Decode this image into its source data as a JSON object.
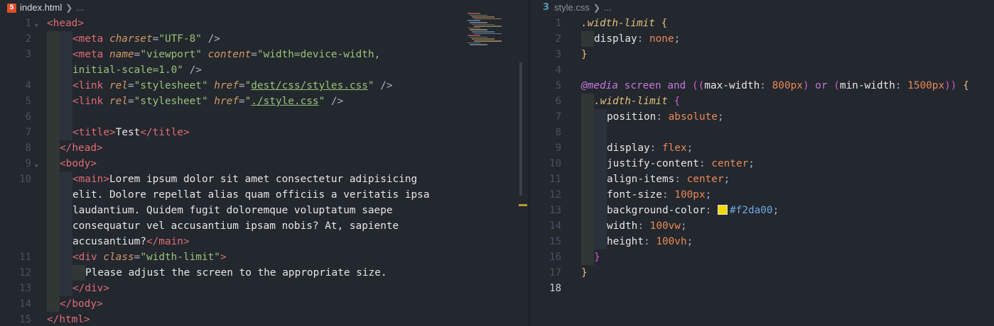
{
  "left_editor": {
    "file_name": "index.html",
    "breadcrumb_more": "...",
    "lines": [
      {
        "n": "1",
        "code": [
          [
            "tag",
            "<head>"
          ]
        ],
        "ind": 0,
        "fold": true
      },
      {
        "n": "2",
        "code": [
          [
            "tag",
            "<meta "
          ],
          [
            "attr",
            "charset"
          ],
          [
            "punct",
            "="
          ],
          [
            "str",
            "\"UTF-8\""
          ],
          [
            "punct",
            " />"
          ]
        ],
        "ind": 2
      },
      {
        "n": "3",
        "code": [
          [
            "tag",
            "<meta "
          ],
          [
            "attr",
            "name"
          ],
          [
            "punct",
            "="
          ],
          [
            "str",
            "\"viewport\""
          ],
          [
            "punct",
            " "
          ],
          [
            "attr",
            "content"
          ],
          [
            "punct",
            "="
          ],
          [
            "str",
            "\"width=device-width,"
          ]
        ],
        "ind": 2
      },
      {
        "n": "",
        "code": [
          [
            "str",
            "initial-scale=1.0\""
          ],
          [
            "punct",
            " />"
          ]
        ],
        "ind": 2
      },
      {
        "n": "4",
        "code": [
          [
            "tag",
            "<link "
          ],
          [
            "attr",
            "rel"
          ],
          [
            "punct",
            "="
          ],
          [
            "str",
            "\"stylesheet\""
          ],
          [
            "punct",
            " "
          ],
          [
            "attr",
            "href"
          ],
          [
            "punct",
            "="
          ],
          [
            "str",
            "\""
          ],
          [
            "strul",
            "dest/css/styles.css"
          ],
          [
            "str",
            "\""
          ],
          [
            "punct",
            " />"
          ]
        ],
        "ind": 2
      },
      {
        "n": "5",
        "code": [
          [
            "tag",
            "<link "
          ],
          [
            "attr",
            "rel"
          ],
          [
            "punct",
            "="
          ],
          [
            "str",
            "\"stylesheet\""
          ],
          [
            "punct",
            " "
          ],
          [
            "attr",
            "href"
          ],
          [
            "punct",
            "="
          ],
          [
            "str",
            "\""
          ],
          [
            "strul",
            "./style.css"
          ],
          [
            "str",
            "\""
          ],
          [
            "punct",
            " />"
          ]
        ],
        "ind": 2
      },
      {
        "n": "6",
        "code": [],
        "ind": 2
      },
      {
        "n": "7",
        "code": [
          [
            "tag",
            "<title>"
          ],
          [
            "txt",
            "Test"
          ],
          [
            "tag",
            "</title>"
          ]
        ],
        "ind": 2
      },
      {
        "n": "8",
        "code": [
          [
            "tag",
            "</head>"
          ]
        ],
        "ind": 1
      },
      {
        "n": "9",
        "code": [
          [
            "tag",
            "<body>"
          ]
        ],
        "ind": 1,
        "fold": true
      },
      {
        "n": "10",
        "code": [
          [
            "tag",
            "<main>"
          ],
          [
            "txt",
            "Lorem ipsum dolor sit amet consectetur adipisicing"
          ]
        ],
        "ind": 2
      },
      {
        "n": "",
        "code": [
          [
            "txt",
            "elit. Dolore repellat alias quam officiis a veritatis ipsa"
          ]
        ],
        "ind": 2
      },
      {
        "n": "",
        "code": [
          [
            "txt",
            "laudantium. Quidem fugit doloremque voluptatum saepe"
          ]
        ],
        "ind": 2
      },
      {
        "n": "",
        "code": [
          [
            "txt",
            "consequatur vel accusantium ipsam nobis? At, sapiente"
          ]
        ],
        "ind": 2
      },
      {
        "n": "",
        "code": [
          [
            "txt",
            "accusantium?"
          ],
          [
            "tag",
            "</main>"
          ]
        ],
        "ind": 2
      },
      {
        "n": "11",
        "code": [
          [
            "tag",
            "<div "
          ],
          [
            "attr",
            "class"
          ],
          [
            "punct",
            "="
          ],
          [
            "str",
            "\"width-limit\""
          ],
          [
            "tag",
            ">"
          ]
        ],
        "ind": 2
      },
      {
        "n": "12",
        "code": [
          [
            "txt",
            "Please adjust the screen to the appropriate size."
          ]
        ],
        "ind": 3
      },
      {
        "n": "13",
        "code": [
          [
            "tag",
            "</div>"
          ]
        ],
        "ind": 2
      },
      {
        "n": "14",
        "code": [
          [
            "tag",
            "</body>"
          ]
        ],
        "ind": 1
      },
      {
        "n": "15",
        "code": [
          [
            "tag",
            "</html>"
          ]
        ],
        "ind": 0
      }
    ]
  },
  "right_editor": {
    "file_name": "style.css",
    "breadcrumb_more": "...",
    "lines": [
      {
        "n": "1",
        "code": [
          [
            "sel",
            ".width-limit"
          ],
          [
            "punct",
            " "
          ],
          [
            "brace2",
            "{"
          ]
        ],
        "ind": 0
      },
      {
        "n": "2",
        "code": [
          [
            "prop",
            "display"
          ],
          [
            "punct",
            ": "
          ],
          [
            "val",
            "none"
          ],
          [
            "punct",
            ";"
          ]
        ],
        "ind": 1
      },
      {
        "n": "3",
        "code": [
          [
            "brace2",
            "}"
          ]
        ],
        "ind": 0
      },
      {
        "n": "4",
        "code": [],
        "ind": 0
      },
      {
        "n": "5",
        "code": [
          [
            "atrule",
            "@media"
          ],
          [
            "punct",
            " "
          ],
          [
            "kw",
            "screen"
          ],
          [
            "punct",
            " "
          ],
          [
            "kw",
            "and"
          ],
          [
            "punct",
            " "
          ],
          [
            "paren",
            "(("
          ],
          [
            "prop",
            "max-width"
          ],
          [
            "punct",
            ": "
          ],
          [
            "num",
            "800px"
          ],
          [
            "paren",
            ")"
          ],
          [
            "punct",
            " "
          ],
          [
            "kw",
            "or"
          ],
          [
            "punct",
            " "
          ],
          [
            "paren",
            "("
          ],
          [
            "prop",
            "min-width"
          ],
          [
            "punct",
            ": "
          ],
          [
            "num",
            "1500px"
          ],
          [
            "paren",
            "))"
          ],
          [
            "punct",
            " "
          ],
          [
            "brace2",
            "{"
          ]
        ],
        "ind": 0
      },
      {
        "n": "6",
        "code": [
          [
            "sel",
            ".width-limit"
          ],
          [
            "punct",
            " "
          ],
          [
            "brace",
            "{"
          ]
        ],
        "ind": 1
      },
      {
        "n": "7",
        "code": [
          [
            "prop",
            "position"
          ],
          [
            "punct",
            ": "
          ],
          [
            "val",
            "absolute"
          ],
          [
            "punct",
            ";"
          ]
        ],
        "ind": 2
      },
      {
        "n": "8",
        "code": [],
        "ind": 2
      },
      {
        "n": "9",
        "code": [
          [
            "prop",
            "display"
          ],
          [
            "punct",
            ": "
          ],
          [
            "val",
            "flex"
          ],
          [
            "punct",
            ";"
          ]
        ],
        "ind": 2
      },
      {
        "n": "10",
        "code": [
          [
            "prop",
            "justify-content"
          ],
          [
            "punct",
            ": "
          ],
          [
            "val",
            "center"
          ],
          [
            "punct",
            ";"
          ]
        ],
        "ind": 2
      },
      {
        "n": "11",
        "code": [
          [
            "prop",
            "align-items"
          ],
          [
            "punct",
            ": "
          ],
          [
            "val",
            "center"
          ],
          [
            "punct",
            ";"
          ]
        ],
        "ind": 2
      },
      {
        "n": "12",
        "code": [
          [
            "prop",
            "font-size"
          ],
          [
            "punct",
            ": "
          ],
          [
            "num",
            "100px"
          ],
          [
            "punct",
            ";"
          ]
        ],
        "ind": 2
      },
      {
        "n": "13",
        "code": [
          [
            "prop",
            "background-color"
          ],
          [
            "punct",
            ": "
          ],
          [
            "swatch",
            ""
          ],
          [
            "hex",
            "#f2da00"
          ],
          [
            "punct",
            ";"
          ]
        ],
        "ind": 2
      },
      {
        "n": "14",
        "code": [
          [
            "prop",
            "width"
          ],
          [
            "punct",
            ": "
          ],
          [
            "num",
            "100vw"
          ],
          [
            "punct",
            ";"
          ]
        ],
        "ind": 2
      },
      {
        "n": "15",
        "code": [
          [
            "prop",
            "height"
          ],
          [
            "punct",
            ": "
          ],
          [
            "num",
            "100vh"
          ],
          [
            "punct",
            ";"
          ]
        ],
        "ind": 2
      },
      {
        "n": "16",
        "code": [
          [
            "brace",
            "}"
          ]
        ],
        "ind": 1
      },
      {
        "n": "17",
        "code": [
          [
            "brace2",
            "}"
          ]
        ],
        "ind": 0
      },
      {
        "n": "18",
        "code": [],
        "ind": 0,
        "active": true
      }
    ]
  },
  "colors": {
    "swatch": "#f2da00",
    "editor_bg": "#23272e"
  }
}
